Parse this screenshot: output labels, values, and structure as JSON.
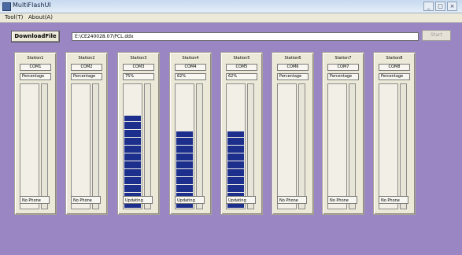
{
  "window": {
    "title": "MultiFlashUI"
  },
  "menu": [
    {
      "label": "Tool(T)"
    },
    {
      "label": "About(A)"
    }
  ],
  "toolbar": {
    "download_label": "DownloadFile",
    "path_value": "E:\\CE240028.07\\PCL.ddx",
    "start_label": "Start"
  },
  "stations": [
    {
      "title": "Station1",
      "port": "COM1",
      "percent_text": "Percentage",
      "status": "No Phone",
      "progress": 0
    },
    {
      "title": "Station2",
      "port": "COM2",
      "percent_text": "Percentage",
      "status": "No Phone",
      "progress": 0
    },
    {
      "title": "Station3",
      "port": "COM3",
      "percent_text": "75%",
      "status": "Updating",
      "progress": 0.75
    },
    {
      "title": "Station4",
      "port": "COM4",
      "percent_text": "62%",
      "status": "Updating",
      "progress": 0.62
    },
    {
      "title": "Station5",
      "port": "COM5",
      "percent_text": "62%",
      "status": "Updating",
      "progress": 0.62
    },
    {
      "title": "Station6",
      "port": "COM6",
      "percent_text": "Percentage",
      "status": "No Phone",
      "progress": 0
    },
    {
      "title": "Station7",
      "port": "COM7",
      "percent_text": "Percentage",
      "status": "No Phone",
      "progress": 0
    },
    {
      "title": "Station8",
      "port": "COM8",
      "percent_text": "Percentage",
      "status": "No Phone",
      "progress": 0
    }
  ],
  "colors": {
    "background": "#9b86c4",
    "progress_fill": "#1d2f8c",
    "panel": "#ece9d8"
  }
}
